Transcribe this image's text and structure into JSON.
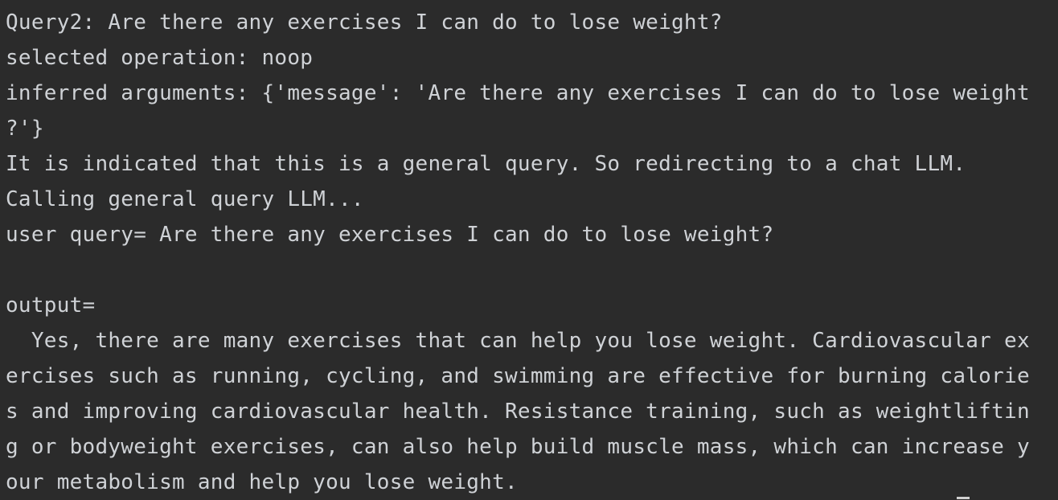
{
  "console": {
    "lines": [
      "Query2: Are there any exercises I can do to lose weight?",
      "selected operation: noop",
      "inferred arguments: {'message': 'Are there any exercises I can do to lose weight",
      "?'}",
      "It is indicated that this is a general query. So redirecting to a chat LLM.",
      "Calling general query LLM...",
      "user query= Are there any exercises I can do to lose weight?",
      "",
      "output=",
      "  Yes, there are many exercises that can help you lose weight. Cardiovascular ex",
      "ercises such as running, cycling, and swimming are effective for burning calorie",
      "s and improving cardiovascular health. Resistance training, such as weightliftin",
      "g or bodyweight exercises, can also help build muscle mass, which can increase y",
      "our metabolism and help you lose weight."
    ]
  },
  "colors": {
    "background": "#2b2b2b",
    "text": "#cfd2d6"
  }
}
